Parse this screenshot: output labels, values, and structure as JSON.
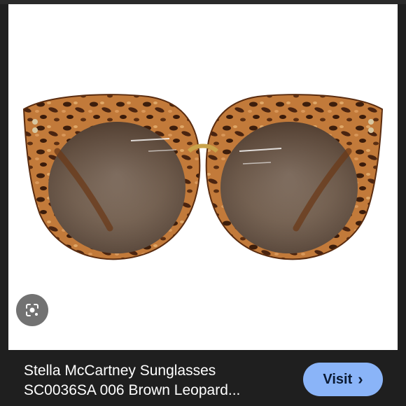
{
  "result_card": {
    "title_line_1": "Stella McCartney Sunglasses",
    "title_line_2": "SC0036SA 006 Brown Leopard...",
    "visit_label": "Visit",
    "visit_chevron": "›"
  },
  "icons": {
    "lens": "google-lens-icon",
    "chevron": "chevron-right-icon"
  },
  "colors": {
    "visit_button_bg": "#8ab4f8",
    "bar_bg": "#1f1f1f",
    "frame_tortoise": "#8a4a1e",
    "lens_tint": "#6e5a4a"
  }
}
